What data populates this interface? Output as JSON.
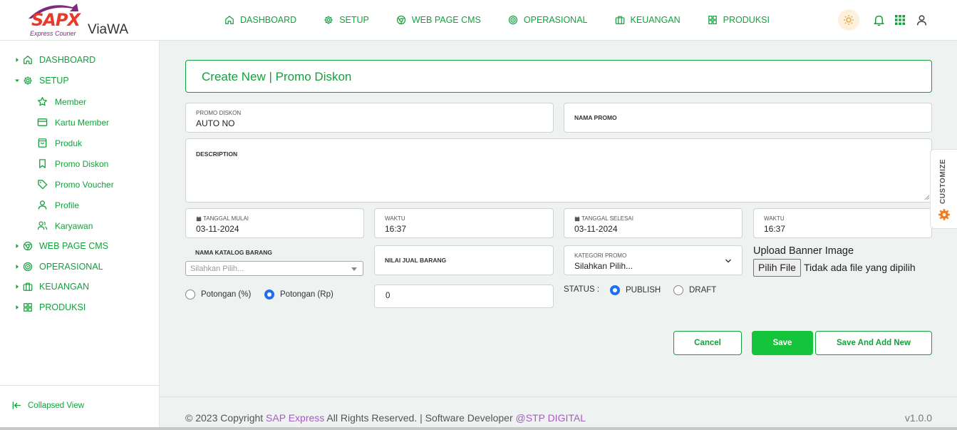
{
  "brand": {
    "logo_text": "SAPX",
    "logo_sub": "Express Courier",
    "app_name": "ViaWA"
  },
  "topnav": [
    {
      "label": "DASHBOARD",
      "icon": "home-icon"
    },
    {
      "label": "SETUP",
      "icon": "gear-icon"
    },
    {
      "label": "WEB PAGE CMS",
      "icon": "chrome-icon"
    },
    {
      "label": "OPERASIONAL",
      "icon": "target-icon"
    },
    {
      "label": "KEUANGAN",
      "icon": "briefcase-icon"
    },
    {
      "label": "PRODUKSI",
      "icon": "grid-icon"
    }
  ],
  "sidebar": {
    "items": [
      {
        "label": "DASHBOARD",
        "icon": "home-icon"
      },
      {
        "label": "SETUP",
        "icon": "gear-icon",
        "expanded": true
      },
      {
        "label": "WEB PAGE CMS",
        "icon": "chrome-icon"
      },
      {
        "label": "OPERASIONAL",
        "icon": "target-icon"
      },
      {
        "label": "KEUANGAN",
        "icon": "briefcase-icon"
      },
      {
        "label": "PRODUKSI",
        "icon": "grid-icon"
      }
    ],
    "setup_children": [
      {
        "label": "Member",
        "icon": "star-icon"
      },
      {
        "label": "Kartu Member",
        "icon": "credit-card-icon"
      },
      {
        "label": "Produk",
        "icon": "shopping-bag-icon"
      },
      {
        "label": "Promo Diskon",
        "icon": "bookmark-icon"
      },
      {
        "label": "Promo Voucher",
        "icon": "tag-icon"
      },
      {
        "label": "Profile",
        "icon": "user-icon"
      },
      {
        "label": "Karyawan",
        "icon": "users-icon"
      }
    ],
    "collapse_label": "Collapsed View"
  },
  "page": {
    "title": "Create New | Promo Diskon"
  },
  "form": {
    "promo_diskon": {
      "label": "PROMO DISKON",
      "value": "AUTO NO"
    },
    "nama_promo": {
      "label": "NAMA PROMO"
    },
    "description": {
      "label": "DESCRIPTION"
    },
    "tanggal_mulai": {
      "label": "TANGGAL MULAI",
      "value": "03-11-2024"
    },
    "waktu_mulai": {
      "label": "WAKTU",
      "value": "16:37"
    },
    "tanggal_selesai": {
      "label": "TANGGAL SELESAI",
      "value": "03-11-2024"
    },
    "waktu_selesai": {
      "label": "WAKTU",
      "value": "16:37"
    },
    "nama_katalog": {
      "label": "NAMA KATALOG BARANG",
      "placeholder": "Silahkan Pilih..."
    },
    "nilai_jual": {
      "label": "NILAI JUAL BARANG"
    },
    "kategori_promo": {
      "label": "KATEGORI PROMO",
      "value": "Silahkan Pilih..."
    },
    "upload": {
      "title": "Upload Banner Image",
      "button": "Pilih File",
      "no_file": "Tidak ada file yang dipilih"
    },
    "potongan": {
      "option_percent": "Potongan (%)",
      "option_rp": "Potongan (Rp)",
      "selected": "rp"
    },
    "potongan_value": "0",
    "status": {
      "label": "STATUS :",
      "publish": "PUBLISH",
      "draft": "DRAFT",
      "selected": "publish"
    }
  },
  "buttons": {
    "cancel": "Cancel",
    "save": "Save",
    "save_add": "Save And Add New"
  },
  "customize_label": "CUSTOMIZE",
  "footer": {
    "copyright_prefix": "© 2023 Copyright",
    "company": "SAP Express",
    "rights": "All Rights Reserved. | Software Developer",
    "developer": "@STP DIGITAL",
    "version": "v1.0.0"
  },
  "colors": {
    "accent": "#14a03c",
    "save": "#14c43a",
    "radio": "#1e6ef0",
    "brand_link": "#a45ec0",
    "customize_gear": "#f47c20"
  }
}
